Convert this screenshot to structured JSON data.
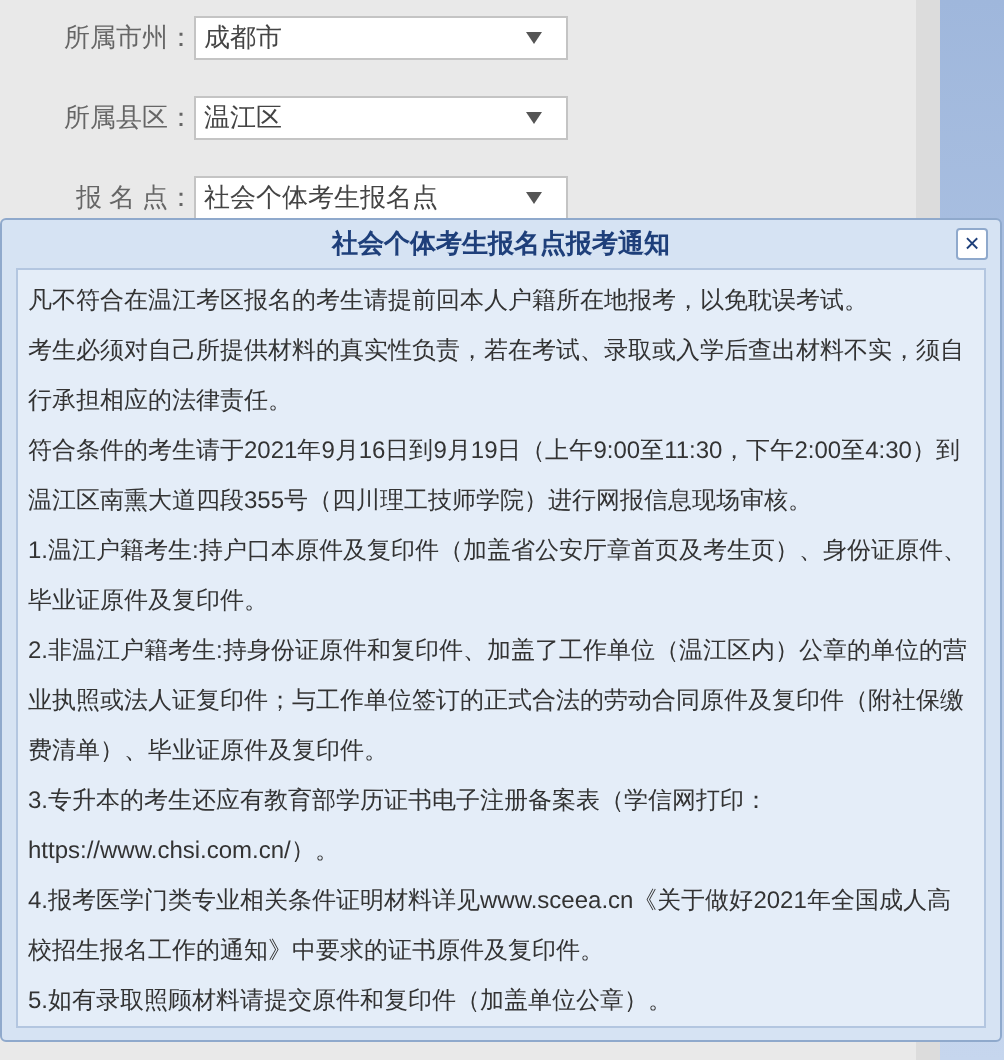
{
  "form": {
    "fields": [
      {
        "label": "所属市州：",
        "value": "成都市"
      },
      {
        "label": "所属县区：",
        "value": "温江区"
      },
      {
        "label": "报 名 点：",
        "value": "社会个体考生报名点"
      }
    ]
  },
  "dialog": {
    "title": "社会个体考生报名点报考通知",
    "close": "×",
    "paragraphs": [
      "凡不符合在温江考区报名的考生请提前回本人户籍所在地报考，以免耽误考试。",
      "考生必须对自己所提供材料的真实性负责，若在考试、录取或入学后查出材料不实，须自行承担相应的法律责任。",
      "符合条件的考生请于2021年9月16日到9月19日（上午9:00至11:30，下午2:00至4:30）到温江区南熏大道四段355号（四川理工技师学院）进行网报信息现场审核。",
      "1.温江户籍考生:持户口本原件及复印件（加盖省公安厅章首页及考生页）、身份证原件、毕业证原件及复印件。",
      "2.非温江户籍考生:持身份证原件和复印件、加盖了工作单位（温江区内）公章的单位的营业执照或法人证复印件；与工作单位签订的正式合法的劳动合同原件及复印件（附社保缴费清单）、毕业证原件及复印件。",
      "3.专升本的考生还应有教育部学历证书电子注册备案表（学信网打印：https://www.chsi.com.cn/）。",
      "4.报考医学门类专业相关条件证明材料详见www.sceea.cn《关于做好2021年全国成人高校招生报名工作的通知》中要求的证书原件及复印件。",
      "5.如有录取照顾材料请提交原件和复印件（加盖单位公章）。"
    ]
  }
}
